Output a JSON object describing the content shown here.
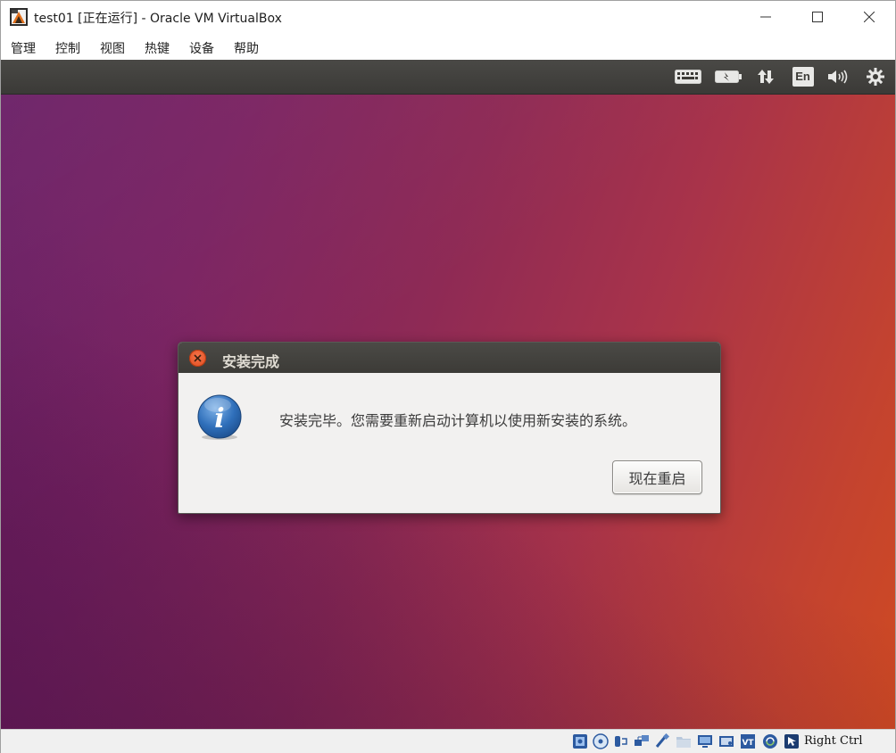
{
  "window": {
    "title": "test01 [正在运行] - Oracle VM VirtualBox"
  },
  "menu": {
    "items": [
      "管理",
      "控制",
      "视图",
      "热键",
      "设备",
      "帮助"
    ]
  },
  "panel": {
    "indicators": [
      "keyboard-icon",
      "battery-icon",
      "network-icon",
      "input-method-icon",
      "volume-icon",
      "system-gear-icon"
    ],
    "input_method_label": "En"
  },
  "dialog": {
    "title": "安装完成",
    "message": "安装完毕。您需要重新启动计算机以使用新安装的系统。",
    "restart_button": "现在重启"
  },
  "statusbar": {
    "icons": [
      "hard-disk-icon",
      "optical-drive-icon",
      "audio-icon",
      "network-adapter-icon",
      "usb-icon",
      "shared-folders-icon",
      "display-icon",
      "video-capture-icon",
      "virtualization-icon",
      "mouse-integration-icon",
      "host-key-icon"
    ],
    "host_key": "Right Ctrl"
  },
  "colors": {
    "panel": "#3c3b37",
    "dialog_bg": "#f2f1f0",
    "close_button": "#df4a1c",
    "desktop_left": "#6a1f66",
    "desktop_right": "#cf4a22"
  }
}
